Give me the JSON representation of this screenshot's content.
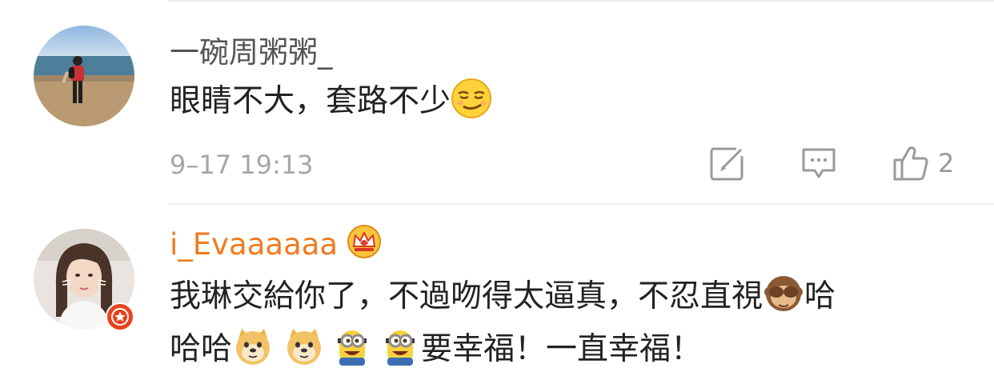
{
  "comments": [
    {
      "username": "一碗周粥粥_",
      "text_part1": "眼睛不大，套路不少",
      "emoji": "smirk-emoji",
      "timestamp": "9–17 19:13",
      "actions": {
        "forward_icon": "edit-square-icon",
        "reply_icon": "comment-bubble-icon",
        "like_icon": "thumbs-up-icon",
        "like_count": "2"
      }
    },
    {
      "username": "i_Evaaaaaa",
      "username_color": "#f07b1e",
      "badge_icon": "crown-badge-icon",
      "line1_text": "我琳交給你了，不過吻得太逼真，不忍直視",
      "line1_emoji": "see-no-evil-monkey-emoji",
      "line1_tail": "哈",
      "line2_head": "哈哈",
      "line2_emojis": [
        "doge-emoji",
        "doge-emoji",
        "minion-emoji",
        "minion-emoji"
      ],
      "line2_tail": "要幸福！一直幸福！",
      "avatar_badge": "verified-star-badge"
    }
  ],
  "colors": {
    "text_primary": "#222222",
    "text_secondary": "#a6a6a6",
    "username_gray": "#555555",
    "username_orange": "#f07b1e",
    "badge_red": "#e8431f"
  }
}
